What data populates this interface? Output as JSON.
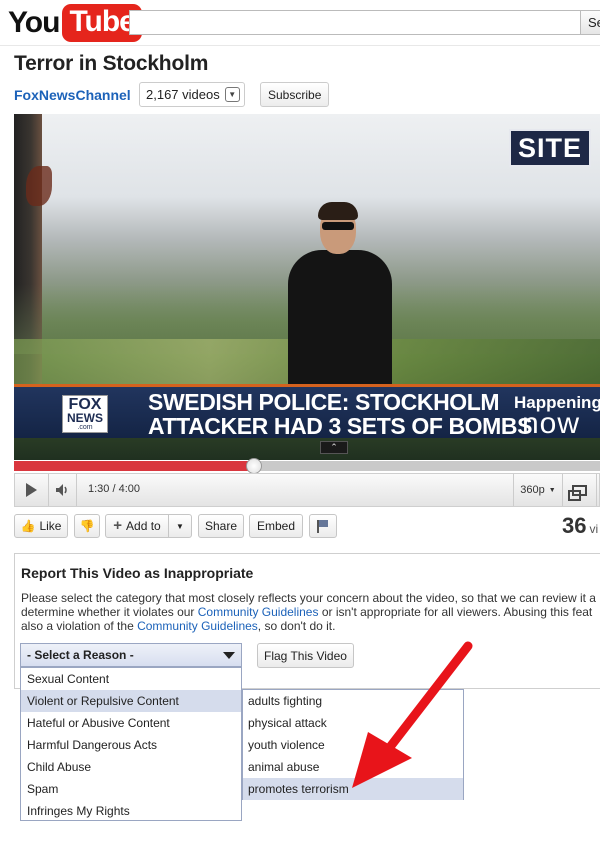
{
  "header": {
    "logo_you": "You",
    "logo_tube": "Tube",
    "search_placeholder": "",
    "search_button_label": "Se"
  },
  "video": {
    "title": "Terror in Stockholm",
    "channel": "FoxNewsChannel",
    "videos_count": "2,167 videos",
    "subscribe_label": "Subscribe",
    "chyron_line_1": "SWEDISH POLICE: STOCKHOLM",
    "chyron_line_2": "ATTACKER HAD 3 SETS OF BOMBS",
    "network_fox": "FOX",
    "network_news": "NEWS",
    "network_com": ".com",
    "happening": "Happening",
    "now": "now",
    "site_logo": "SITE",
    "expand_glyph": "⌃"
  },
  "player": {
    "time": "1:30 / 4:00",
    "progress_fraction": 0.41,
    "quality": "360p",
    "play_icon": "play-icon",
    "volume_icon": "volume-icon"
  },
  "actions": {
    "like": "Like",
    "add_to": "Add to",
    "share": "Share",
    "embed": "Embed",
    "views": "36",
    "views_label": "vi"
  },
  "report": {
    "title": "Report This Video as Inappropriate",
    "text_1a": "Please select the category that most closely reflects your concern about the video, so that we can review it a",
    "text_2a": "determine whether it violates our ",
    "text_2_link": "Community Guidelines",
    "text_2b": " or isn't appropriate for all viewers. Abusing this feat",
    "text_3a": "also a violation of the ",
    "text_3_link": "Community Guidelines",
    "text_3b": ", so don't do it.",
    "select_label": "- Select a Reason -",
    "flag_button": "Flag This Video",
    "reasons": [
      "Sexual Content",
      "Violent or Repulsive Content",
      "Hateful or Abusive Content",
      "Harmful Dangerous Acts",
      "Child Abuse",
      "Spam",
      "Infringes My Rights"
    ],
    "selected_reason_index": 1,
    "sub_reasons": [
      "adults fighting",
      "physical attack",
      "youth violence",
      "animal abuse",
      "promotes terrorism"
    ],
    "selected_sub_reason_index": 4
  },
  "colors": {
    "accent_red": "#e5251c",
    "link_blue": "#1c62b9",
    "progress_red": "#d9363e",
    "annotation_red": "#e8141a"
  }
}
